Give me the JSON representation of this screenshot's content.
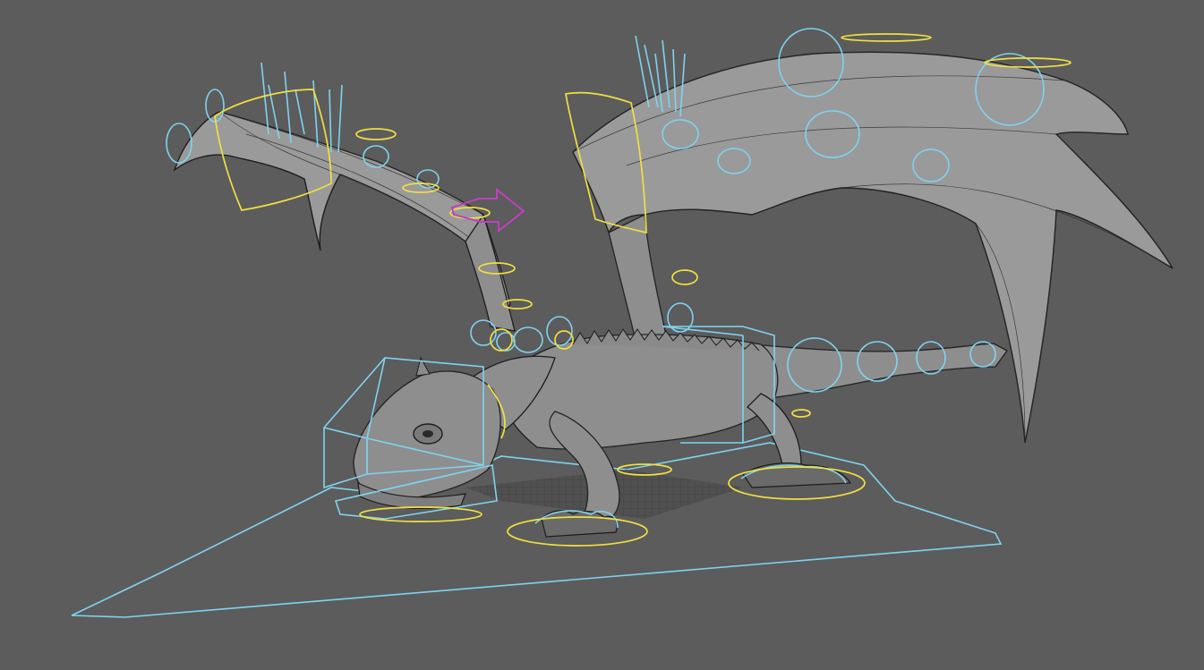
{
  "viewport": {
    "background": "#5c5c5c",
    "subject": "dragon rig"
  },
  "colors": {
    "mesh": "#8e8e8e",
    "wireframe": "#1c1c1c",
    "fk_controls": "#7fd3f0",
    "ik_controls": "#f0e040",
    "selection_manipulator": "#c040c0"
  },
  "icons": {
    "move_manipulator": "move-arrow-icon"
  }
}
